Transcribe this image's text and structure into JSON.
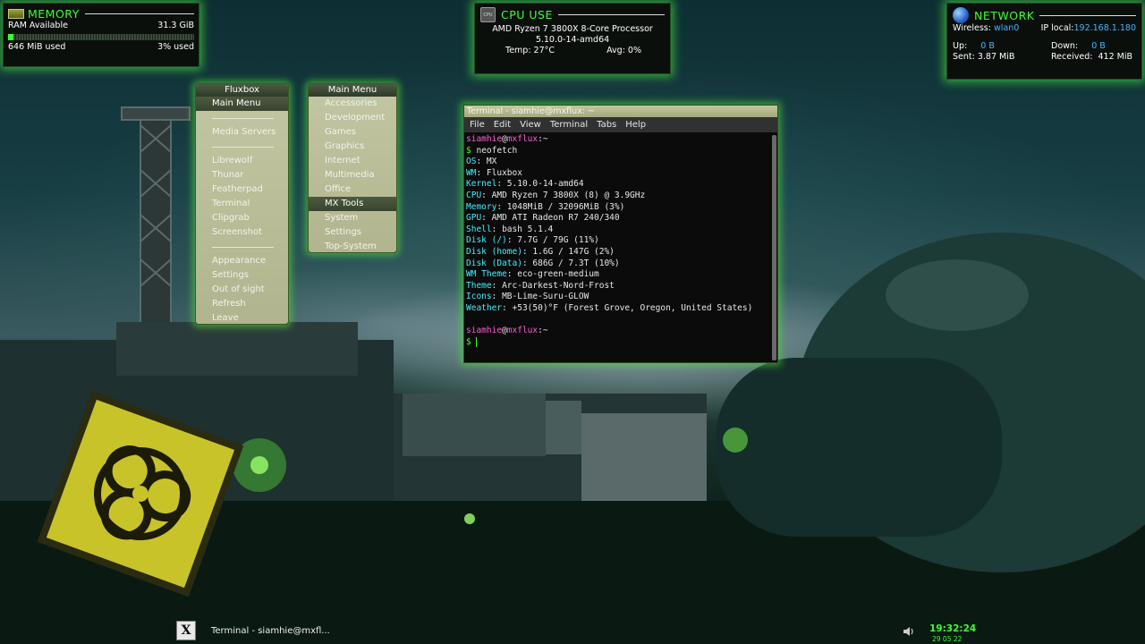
{
  "memory": {
    "title": "MEMORY",
    "ram_label": "RAM Available",
    "ram_total": "31.3 GiB",
    "used": "646 MiB used",
    "percent_label": "3% used",
    "usage_fraction": 0.03
  },
  "cpu": {
    "title": "CPU USE",
    "icon_text": "CPU",
    "model": "AMD Ryzen 7 3800X 8-Core Processor",
    "kernel": "5.10.0-14-amd64",
    "temp": "Temp: 27°C",
    "avg": "Avg:  0%"
  },
  "network": {
    "title": "NETWORK",
    "wireless_label": "Wireless:",
    "wireless_iface": "wlan0",
    "ip_label": "IP local:",
    "ip_value": "192.168.1.180",
    "up_label": "Up:",
    "up_value": "0 B",
    "down_label": "Down:",
    "down_value": "0 B",
    "sent_label": "Sent:",
    "sent_value": "3.87 MiB",
    "received_label": "Received:",
    "received_value": "412 MiB"
  },
  "fluxbox_menu": {
    "title": "Fluxbox",
    "items": [
      {
        "label": "Main Menu",
        "active": true
      },
      {
        "separator": true
      },
      {
        "label": "Media Servers"
      },
      {
        "separator": true
      },
      {
        "label": "Librewolf"
      },
      {
        "label": "Thunar"
      },
      {
        "label": "Featherpad"
      },
      {
        "label": "Terminal"
      },
      {
        "label": "Clipgrab"
      },
      {
        "label": "Screenshot"
      },
      {
        "separator": true
      },
      {
        "label": "Appearance"
      },
      {
        "label": "Settings"
      },
      {
        "label": "Out of sight"
      },
      {
        "label": "Refresh"
      },
      {
        "label": "Leave"
      }
    ]
  },
  "main_menu": {
    "title": "Main Menu",
    "items": [
      {
        "label": "Accessories"
      },
      {
        "label": "Development"
      },
      {
        "label": "Games"
      },
      {
        "label": "Graphics"
      },
      {
        "label": "Internet"
      },
      {
        "label": "Multimedia"
      },
      {
        "label": "Office"
      },
      {
        "label": "MX Tools",
        "active": true
      },
      {
        "label": "System"
      },
      {
        "label": "Settings"
      },
      {
        "label": "Top-System"
      }
    ]
  },
  "terminal": {
    "title": "Terminal - siamhie@mxflux: ~",
    "menu": [
      "File",
      "Edit",
      "View",
      "Terminal",
      "Tabs",
      "Help"
    ],
    "prompt_user": "siamhie",
    "prompt_host": "mxflux",
    "prompt_path": "~",
    "command": "neofetch",
    "info": [
      {
        "key": "OS",
        "value": "MX"
      },
      {
        "key": "WM",
        "value": "Fluxbox"
      },
      {
        "key": "Kernel",
        "value": "5.10.0-14-amd64"
      },
      {
        "key": "CPU",
        "value": "AMD Ryzen 7 3800X (8) @ 3.9GHz"
      },
      {
        "key": "Memory",
        "value": "1048MiB / 32096MiB (3%)"
      },
      {
        "key": "GPU",
        "value": "AMD ATI Radeon R7 240/340"
      },
      {
        "key": "Shell",
        "value": "bash 5.1.4"
      },
      {
        "key": "Disk (/)",
        "value": "7.7G / 79G (11%)"
      },
      {
        "key": "Disk (home)",
        "value": "1.6G / 147G (2%)"
      },
      {
        "key": "Disk (Data)",
        "value": "686G / 7.3T (10%)"
      },
      {
        "key": "WM Theme",
        "value": "eco-green-medium"
      },
      {
        "key": "Theme",
        "value": "Arc-Darkest-Nord-Frost"
      },
      {
        "key": "Icons",
        "value": "MB-Lime-Suru-GLOW"
      },
      {
        "key": "Weather",
        "value": "+53(50)°F (Forest Grove, Oregon, United States)"
      }
    ]
  },
  "taskbar": {
    "task_label": "Terminal - siamhie@mxfl...",
    "time": "19:32:24",
    "date": "29 05 22"
  },
  "colors": {
    "accent": "#3dff2e",
    "glow": "#46e63c",
    "prompt": "#ff5fd7",
    "neofetch_key": "#41f0ff"
  }
}
